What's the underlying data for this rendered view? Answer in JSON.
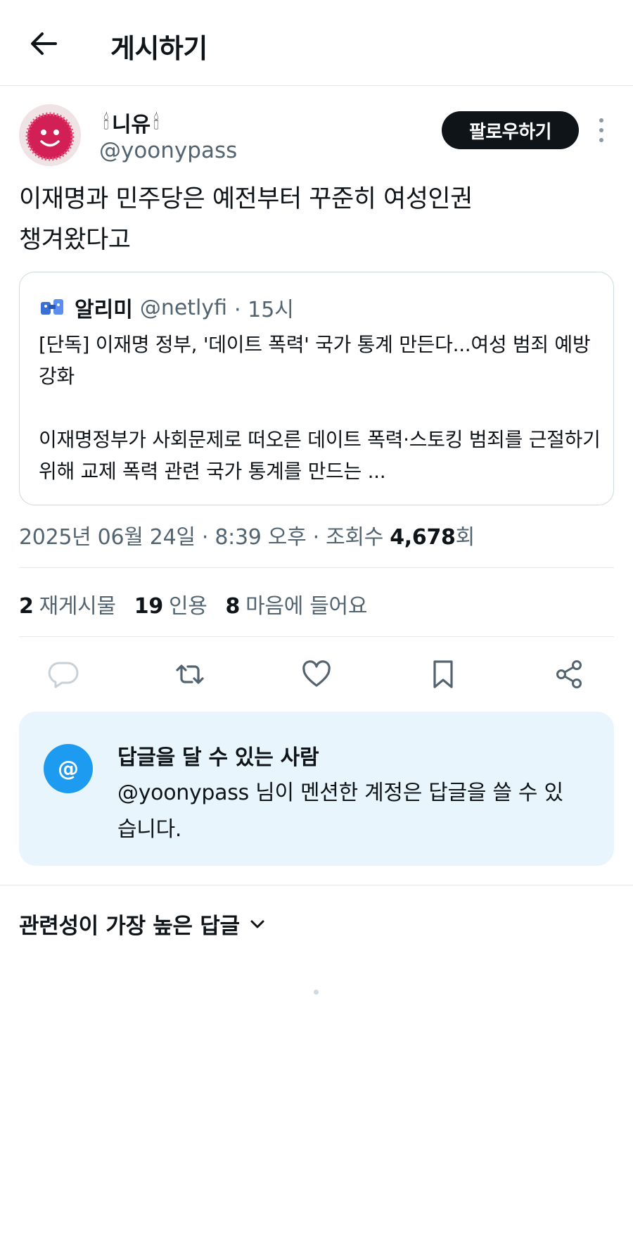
{
  "header": {
    "title": "게시하기",
    "back_icon": "arrow-left-icon"
  },
  "author": {
    "display_name": "니유",
    "name_emoji_left": "🕯",
    "name_emoji_right": "🕯",
    "handle": "@yoonypass",
    "follow_label": "팔로우하기",
    "more_icon": "more-vertical-icon"
  },
  "post": {
    "text_line1": "이재명과 민주당은 예전부터 꾸준히 여성인권",
    "text_line2": "챙겨왔다고"
  },
  "quote": {
    "name": "알리미",
    "handle": "@netlyfi",
    "time": "· 15시",
    "body": "[단독] 이재명 정부, '데이트 폭력' 국가 통계 만든다...여성 범죄 예방 강화\n\n이재명정부가 사회문제로 떠오른 데이트 폭력·스토킹 범죄를 근절하기 위해 교제 폭력 관련 국가 통계를 만드는 ..."
  },
  "meta": {
    "datetime": "2025년 06월 24일 · 8:39 오후 · 조회수 ",
    "views": "4,678",
    "views_suffix": "회"
  },
  "stats": {
    "reposts_count": "2",
    "reposts_label": "재게시물",
    "quotes_count": "19",
    "quotes_label": "인용",
    "likes_count": "8",
    "likes_label": "마음에 들어요"
  },
  "actions": [
    "reply-icon",
    "repost-icon",
    "like-icon",
    "bookmark-icon",
    "share-icon"
  ],
  "reply_restriction": {
    "icon": "@",
    "title": "답글을 달 수 있는 사람",
    "description": "@yoonypass 님이 멘션한 계정은 답글을 쓸 수 있습니다."
  },
  "replies": {
    "sort_label": "관련성이 가장 높은 답글",
    "sort_icon": "chevron-down-icon"
  },
  "colors": {
    "text": "#0f1419",
    "secondary": "#536471",
    "accent": "#1d9bf0",
    "reply_box_bg": "#e8f5fd"
  }
}
